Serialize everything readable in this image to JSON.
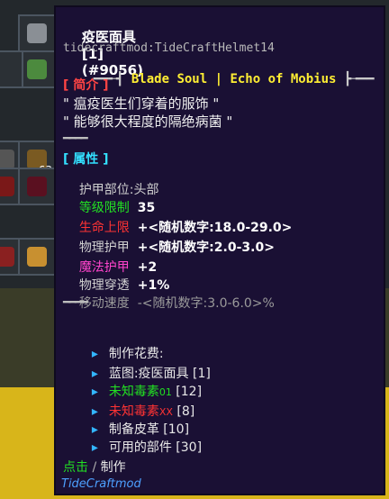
{
  "inventory": {
    "stack_count": "63"
  },
  "tooltip": {
    "title": "疫医面具",
    "title_tag": "[1]",
    "item_id": "(#9056)",
    "internal_name": "tidecraftmod:TideCraftHelmet14",
    "banner_left": "━━╾┫",
    "banner_text": "Blade Soul | Echo of Mobius",
    "banner_right": "┣╼━━",
    "intro_header": "[ 简介 ]",
    "intro_lines": [
      "\" 瘟疫医生们穿着的服饰 \"",
      "\" 能够很大程度的隔绝病菌 \""
    ],
    "divider": "━━━━",
    "attr_header": "[ 属性 ]",
    "attributes": {
      "armor_slot_label": "护甲部位:",
      "armor_slot_value": "头部",
      "level_label": "等级限制",
      "level_value": "35",
      "hp_label": "生命上限",
      "hp_value": "+<随机数字:18.0-29.0>",
      "phys_armor_label": "物理护甲",
      "phys_armor_value": "+<随机数字:2.0-3.0>",
      "magic_armor_label": "魔法护甲",
      "magic_armor_value": "+2",
      "phys_pen_label": "物理穿透",
      "phys_pen_value": "+1%",
      "move_speed_label": "移动速度",
      "move_speed_value": "-<随机数字:3.0-6.0>%"
    },
    "craft": {
      "header": "制作花费:",
      "items": [
        {
          "name": "蓝图:疫医面具",
          "count": "[1]",
          "color": "#e8e8e8"
        },
        {
          "name": "未知毒素",
          "suffix": "01",
          "count": "[12]",
          "color": "#22e022"
        },
        {
          "name": "未知毒素",
          "suffix": "XX",
          "count": "[8]",
          "color": "#ff3333"
        },
        {
          "name": "制备皮革",
          "count": "[10]",
          "color": "#e8e8e8"
        },
        {
          "name": "可用的部件",
          "count": "[30]",
          "color": "#e8e8e8"
        }
      ],
      "bullet": "▸"
    },
    "click_word": "点击",
    "click_sep": "/",
    "click_action": "制作",
    "credit": "TideCraftmod"
  }
}
